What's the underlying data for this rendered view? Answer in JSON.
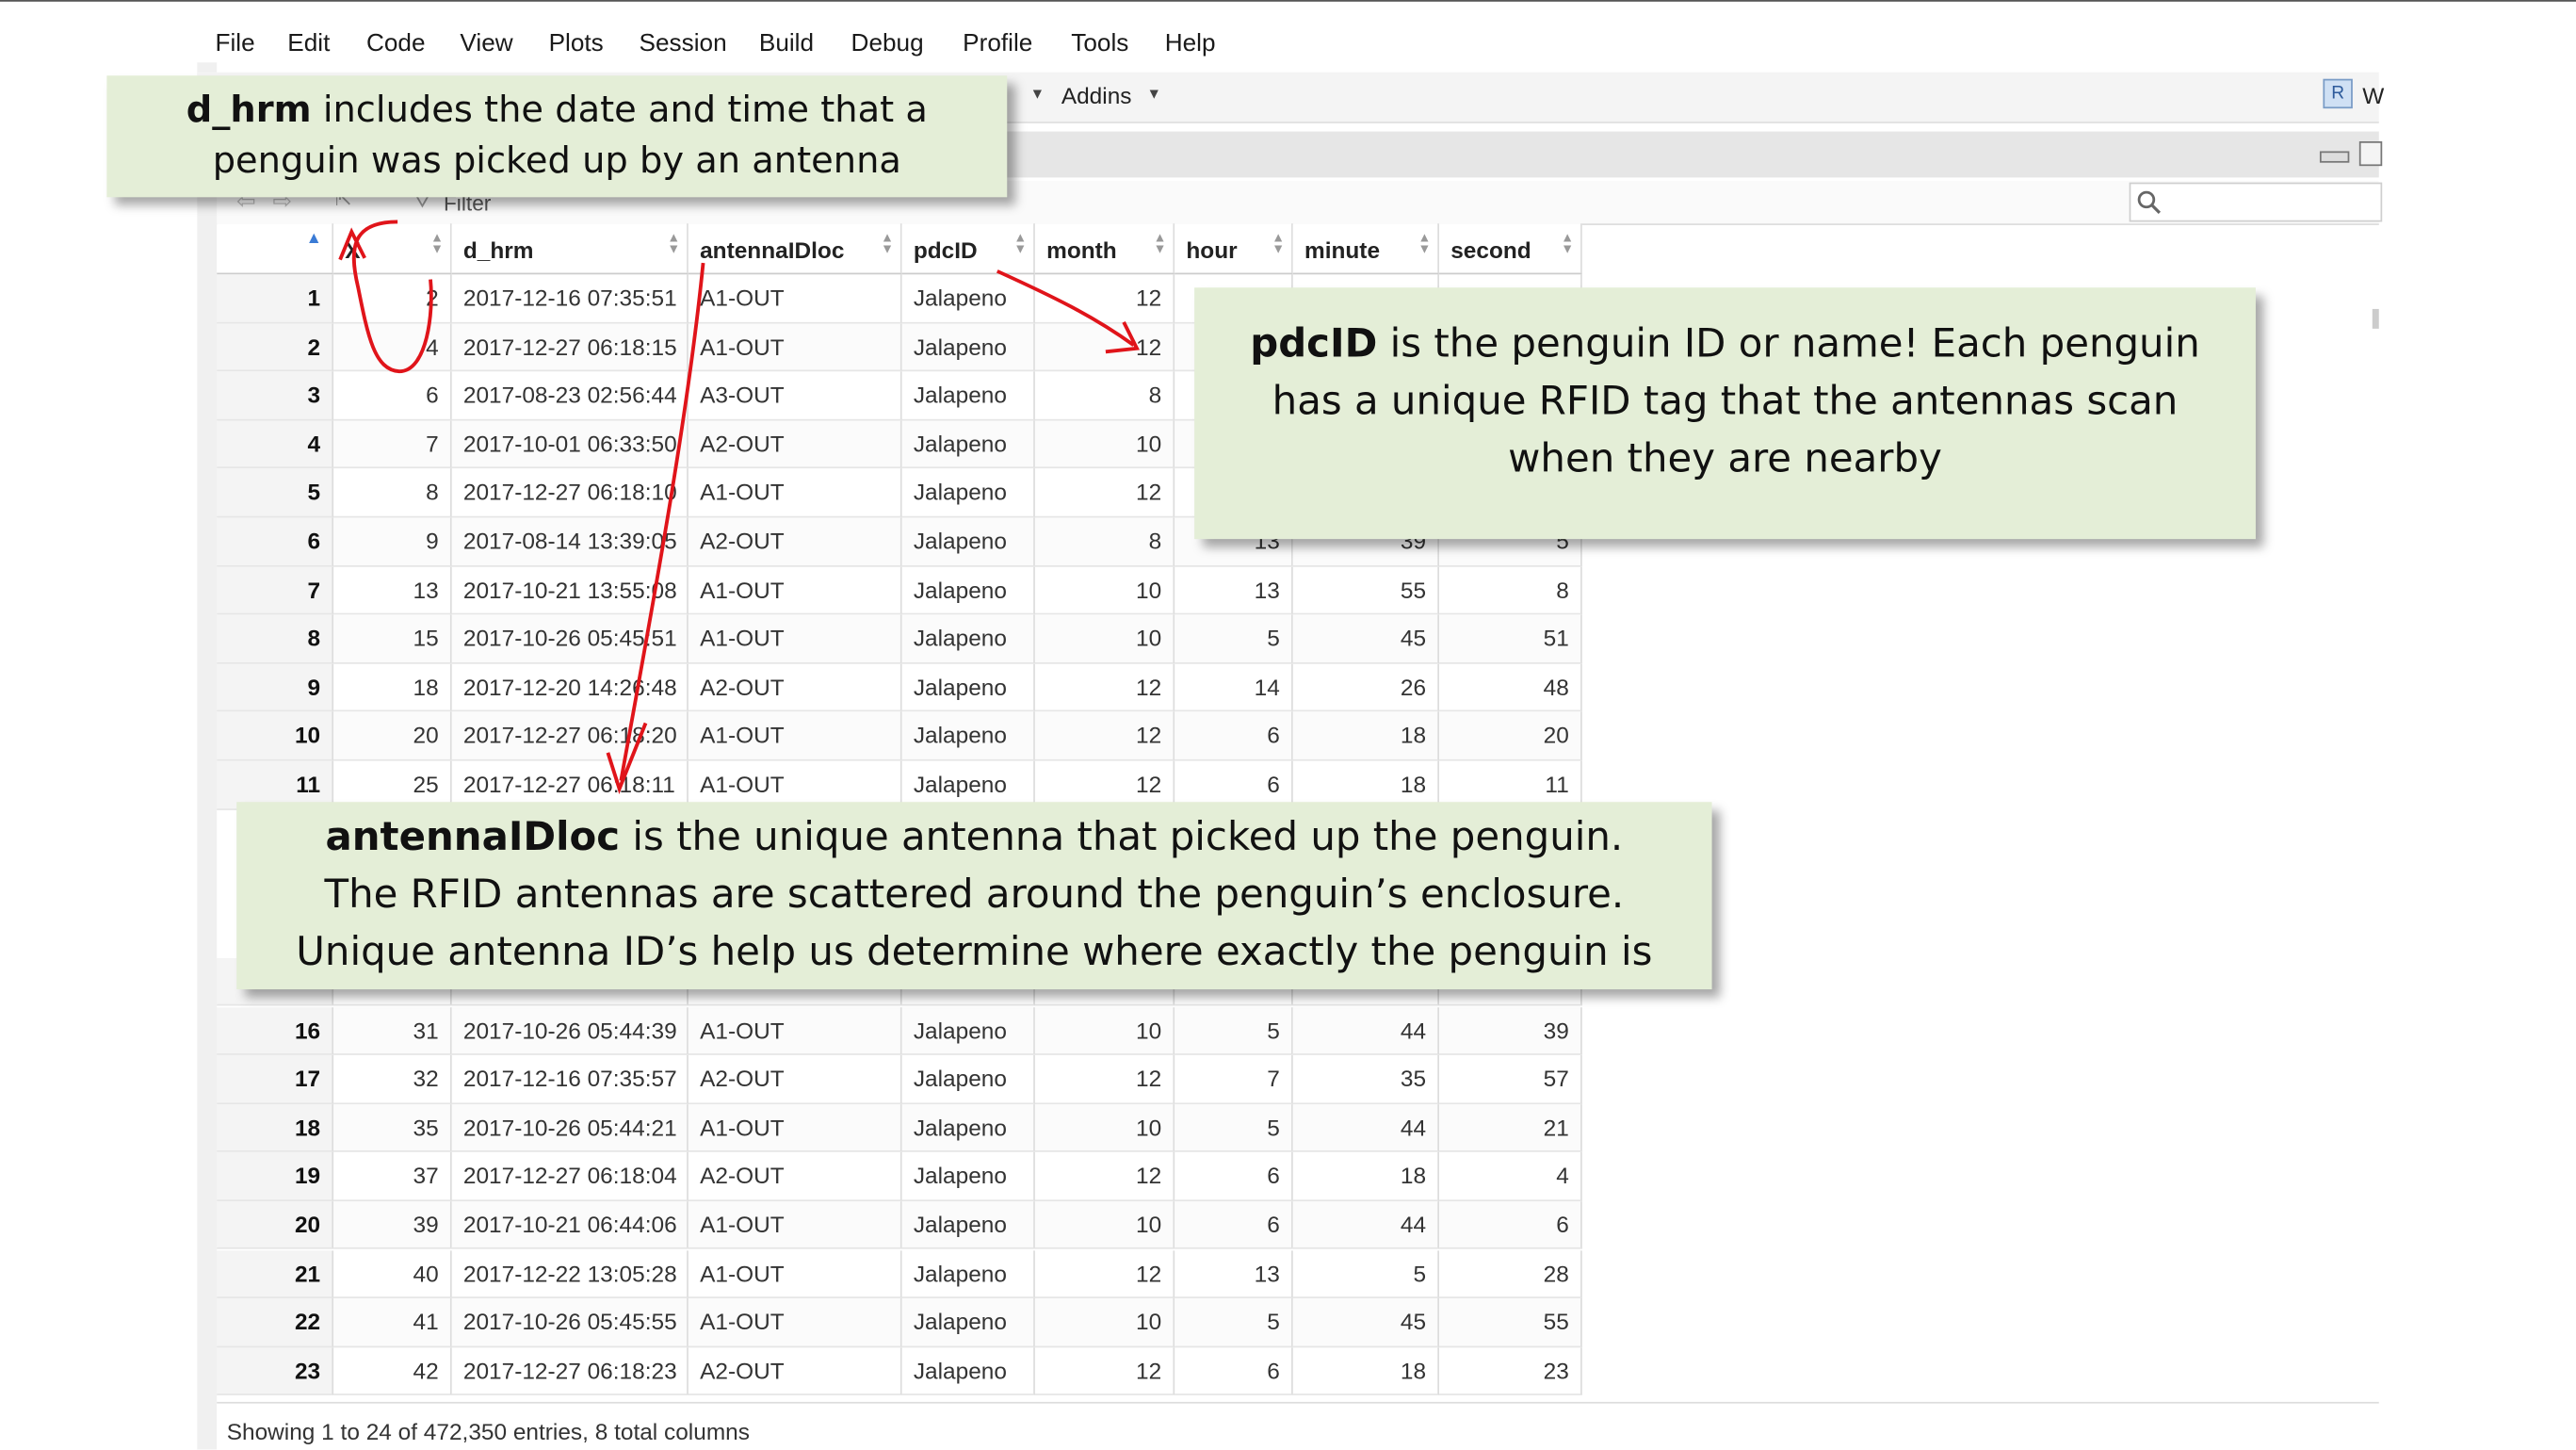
{
  "menu": [
    "File",
    "Edit",
    "Code",
    "View",
    "Plots",
    "Session",
    "Build",
    "Debug",
    "Profile",
    "Tools",
    "Help"
  ],
  "toolbar": {
    "addins_label": "Addins",
    "user_initial": "W"
  },
  "viewer": {
    "filter_label": "Filter",
    "status": "Showing 1 to 24 of 472,350 entries, 8 total columns"
  },
  "table": {
    "columns": [
      "X",
      "d_hrm",
      "antennaIDloc",
      "pdcID",
      "month",
      "hour",
      "minute",
      "second"
    ],
    "rows": [
      [
        "1",
        "2",
        "2017-12-16 07:35:51",
        "A1-OUT",
        "Jalapeno",
        "12",
        "",
        "",
        ""
      ],
      [
        "2",
        "4",
        "2017-12-27 06:18:15",
        "A1-OUT",
        "Jalapeno",
        "12",
        "",
        "",
        ""
      ],
      [
        "3",
        "6",
        "2017-08-23 02:56:44",
        "A3-OUT",
        "Jalapeno",
        "8",
        "",
        "",
        ""
      ],
      [
        "4",
        "7",
        "2017-10-01 06:33:50",
        "A2-OUT",
        "Jalapeno",
        "10",
        "",
        "",
        ""
      ],
      [
        "5",
        "8",
        "2017-12-27 06:18:10",
        "A1-OUT",
        "Jalapeno",
        "12",
        "",
        "",
        ""
      ],
      [
        "6",
        "9",
        "2017-08-14 13:39:05",
        "A2-OUT",
        "Jalapeno",
        "8",
        "13",
        "39",
        "5"
      ],
      [
        "7",
        "13",
        "2017-10-21 13:55:08",
        "A1-OUT",
        "Jalapeno",
        "10",
        "13",
        "55",
        "8"
      ],
      [
        "8",
        "15",
        "2017-10-26 05:45:51",
        "A1-OUT",
        "Jalapeno",
        "10",
        "5",
        "45",
        "51"
      ],
      [
        "9",
        "18",
        "2017-12-20 14:26:48",
        "A2-OUT",
        "Jalapeno",
        "12",
        "14",
        "26",
        "48"
      ],
      [
        "10",
        "20",
        "2017-12-27 06:18:20",
        "A1-OUT",
        "Jalapeno",
        "12",
        "6",
        "18",
        "20"
      ],
      [
        "11",
        "25",
        "2017-12-27 06:18:11",
        "A1-OUT",
        "Jalapeno",
        "12",
        "6",
        "18",
        "11"
      ],
      [
        "16",
        "31",
        "2017-10-26 05:44:39",
        "A1-OUT",
        "Jalapeno",
        "10",
        "5",
        "44",
        "39"
      ],
      [
        "17",
        "32",
        "2017-12-16 07:35:57",
        "A2-OUT",
        "Jalapeno",
        "12",
        "7",
        "35",
        "57"
      ],
      [
        "18",
        "35",
        "2017-10-26 05:44:21",
        "A1-OUT",
        "Jalapeno",
        "10",
        "5",
        "44",
        "21"
      ],
      [
        "19",
        "37",
        "2017-12-27 06:18:04",
        "A2-OUT",
        "Jalapeno",
        "12",
        "6",
        "18",
        "4"
      ],
      [
        "20",
        "39",
        "2017-10-21 06:44:06",
        "A1-OUT",
        "Jalapeno",
        "10",
        "6",
        "44",
        "6"
      ],
      [
        "21",
        "40",
        "2017-12-22 13:05:28",
        "A1-OUT",
        "Jalapeno",
        "12",
        "13",
        "5",
        "28"
      ],
      [
        "22",
        "41",
        "2017-10-26 05:45:55",
        "A1-OUT",
        "Jalapeno",
        "10",
        "5",
        "45",
        "55"
      ],
      [
        "23",
        "42",
        "2017-12-27 06:18:23",
        "A2-OUT",
        "Jalapeno",
        "12",
        "6",
        "18",
        "23"
      ]
    ]
  },
  "notes": {
    "dhrm": {
      "bold": "d_hrm",
      "line1": " includes the date and time that a",
      "line2": "penguin was picked up by an antenna"
    },
    "pdcid": {
      "bold": "pdcID",
      "line1": " is the penguin ID or name! Each penguin",
      "line2": "has a unique RFID tag that the antennas scan",
      "line3": "when they are nearby"
    },
    "antenna": {
      "bold": "antennaIDloc",
      "line1": " is the unique antenna that picked up the penguin.",
      "line2": "The RFID antennas are scattered around the penguin’s enclosure.",
      "line3": "Unique antenna ID’s help us determine where exactly the penguin is"
    }
  },
  "colors": {
    "note_bg": "#e4eed7",
    "arrow": "#e0141a"
  }
}
